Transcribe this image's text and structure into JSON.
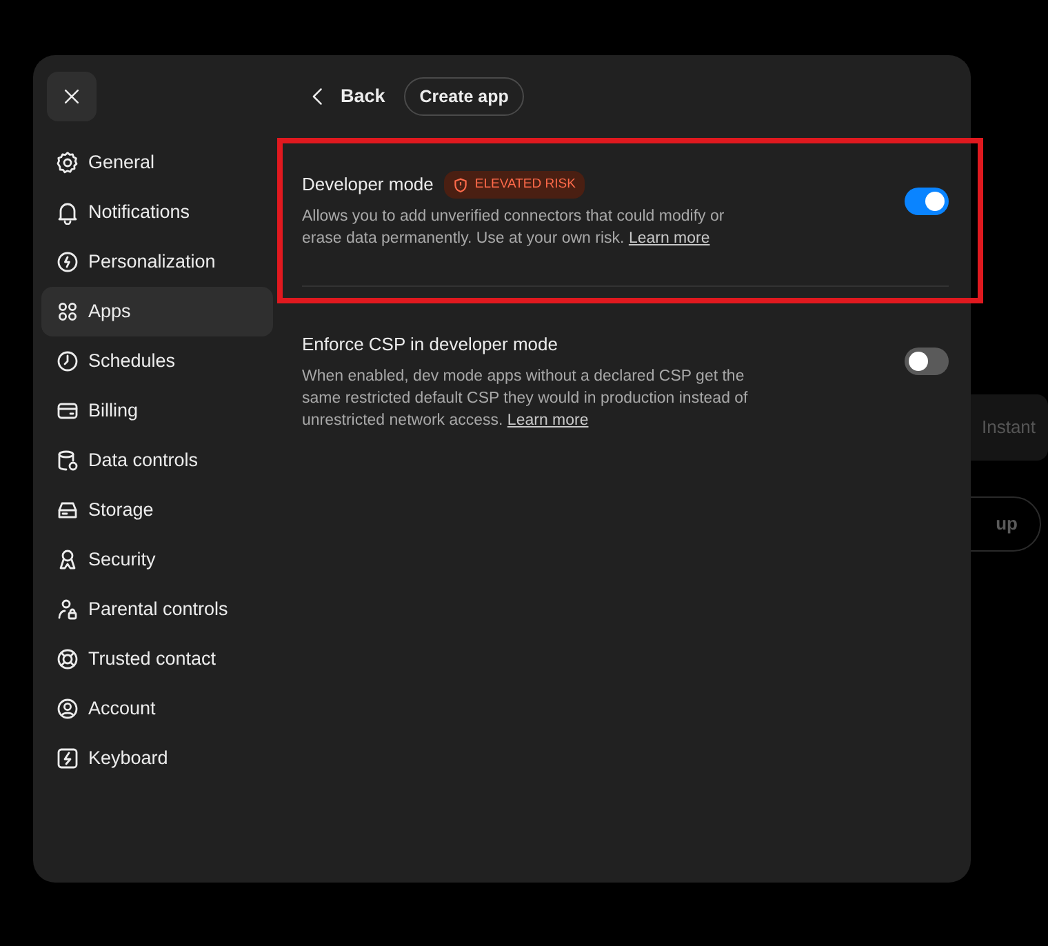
{
  "background": {
    "segment_label": "Instant",
    "button_label": "up"
  },
  "sidebar": {
    "items": [
      {
        "label": "General",
        "selected": false
      },
      {
        "label": "Notifications",
        "selected": false
      },
      {
        "label": "Personalization",
        "selected": false
      },
      {
        "label": "Apps",
        "selected": true
      },
      {
        "label": "Schedules",
        "selected": false
      },
      {
        "label": "Billing",
        "selected": false
      },
      {
        "label": "Data controls",
        "selected": false
      },
      {
        "label": "Storage",
        "selected": false
      },
      {
        "label": "Security",
        "selected": false
      },
      {
        "label": "Parental controls",
        "selected": false
      },
      {
        "label": "Trusted contact",
        "selected": false
      },
      {
        "label": "Account",
        "selected": false
      },
      {
        "label": "Keyboard",
        "selected": false
      }
    ]
  },
  "header": {
    "back": "Back",
    "create": "Create app"
  },
  "settings": [
    {
      "title": "Developer mode",
      "badge": "ELEVATED RISK",
      "description": "Allows you to add unverified connectors that could modify or erase data permanently. Use at your own risk.",
      "link": "Learn more",
      "on": true,
      "highlighted": true
    },
    {
      "title": "Enforce CSP in developer mode",
      "description": "When enabled, dev mode apps without a declared CSP get the same restricted default CSP they would in production instead of unrestricted network access.",
      "link": "Learn more",
      "on": false,
      "highlighted": false
    }
  ]
}
